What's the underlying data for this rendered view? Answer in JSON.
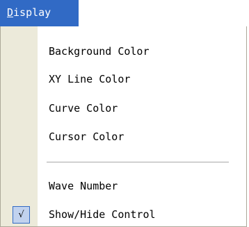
{
  "menubar": {
    "title_mnemonic": "D",
    "title_rest": "isplay"
  },
  "menu": {
    "items": [
      {
        "label": "Background Color",
        "checked": false
      },
      {
        "label": "XY Line Color",
        "checked": false
      },
      {
        "label": "Curve Color",
        "checked": false
      },
      {
        "label": "Cursor Color",
        "checked": false
      },
      {
        "label": "Wave Number",
        "checked": false
      },
      {
        "label": "Show/Hide Control",
        "checked": true,
        "check_glyph": "√"
      }
    ]
  },
  "colors": {
    "menubar_highlight": "#316ac5",
    "gutter": "#eceada",
    "check_background": "#c1d2ee"
  }
}
